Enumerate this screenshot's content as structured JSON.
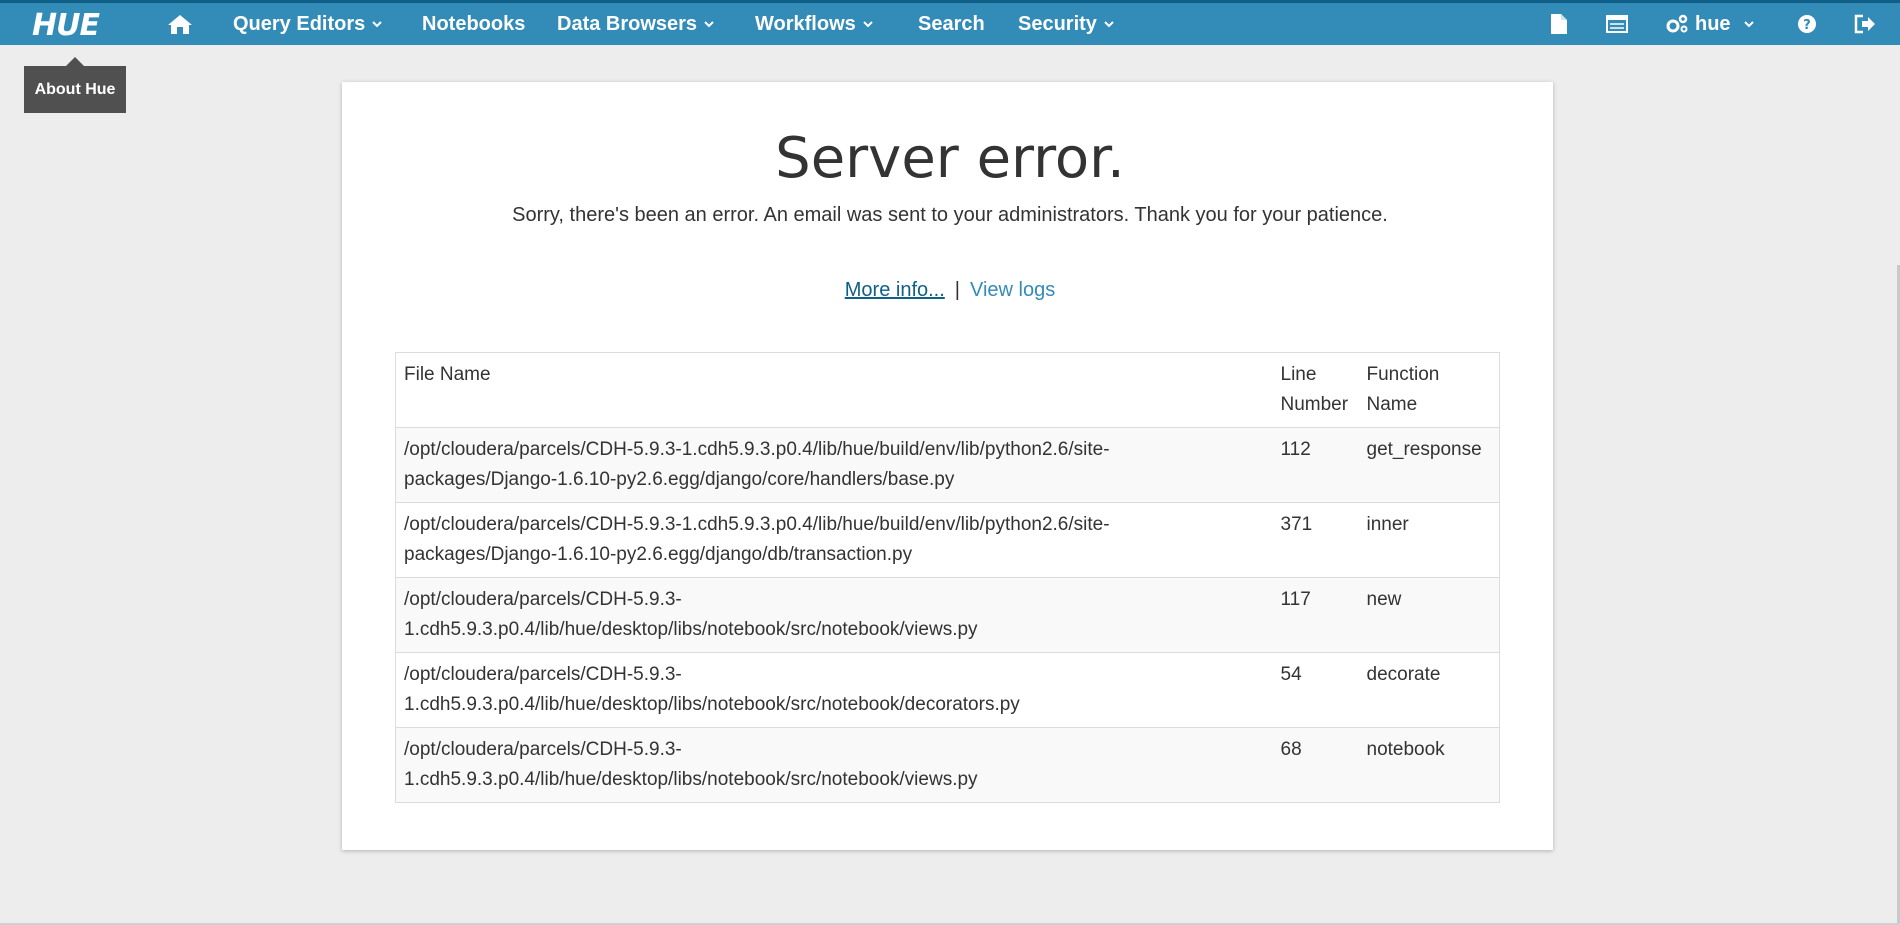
{
  "navbar": {
    "brand": "HUE",
    "items": {
      "home_icon": "home-icon",
      "query_editors": "Query Editors",
      "notebooks": "Notebooks",
      "data_browsers": "Data Browsers",
      "workflows": "Workflows",
      "search": "Search",
      "security": "Security",
      "user": "hue"
    },
    "right_icons": [
      "document-icon",
      "jobs-icon",
      "gears-icon",
      "help-icon",
      "logout-icon"
    ],
    "background_color": "#338bb8"
  },
  "tooltip": {
    "text": "About Hue"
  },
  "error": {
    "title": "Server error.",
    "message": "Sorry, there's been an error. An email was sent to your administrators. Thank you for your patience.",
    "more_info": "More info...",
    "separator": "|",
    "view_logs": "View logs"
  },
  "traceback": {
    "headers": {
      "file": "File Name",
      "line_1": "Line",
      "line_2": "Number",
      "function_1": "Function",
      "function_2": "Name"
    },
    "rows": [
      {
        "file_1": "/opt/cloudera/parcels/CDH-5.9.3-1.cdh5.9.3.p0.4/lib/hue/build/env/lib/python2.6/site-",
        "file_2": "packages/Django-1.6.10-py2.6.egg/django/core/handlers/base.py",
        "line": "112",
        "function": "get_response"
      },
      {
        "file_1": "/opt/cloudera/parcels/CDH-5.9.3-1.cdh5.9.3.p0.4/lib/hue/build/env/lib/python2.6/site-",
        "file_2": "packages/Django-1.6.10-py2.6.egg/django/db/transaction.py",
        "line": "371",
        "function": "inner"
      },
      {
        "file_1": "/opt/cloudera/parcels/CDH-5.9.3-",
        "file_2": "1.cdh5.9.3.p0.4/lib/hue/desktop/libs/notebook/src/notebook/views.py",
        "line": "117",
        "function": "new"
      },
      {
        "file_1": "/opt/cloudera/parcels/CDH-5.9.3-",
        "file_2": "1.cdh5.9.3.p0.4/lib/hue/desktop/libs/notebook/src/notebook/decorators.py",
        "line": "54",
        "function": "decorate"
      },
      {
        "file_1": "/opt/cloudera/parcels/CDH-5.9.3-",
        "file_2": "1.cdh5.9.3.p0.4/lib/hue/desktop/libs/notebook/src/notebook/views.py",
        "line": "68",
        "function": "notebook"
      }
    ]
  }
}
